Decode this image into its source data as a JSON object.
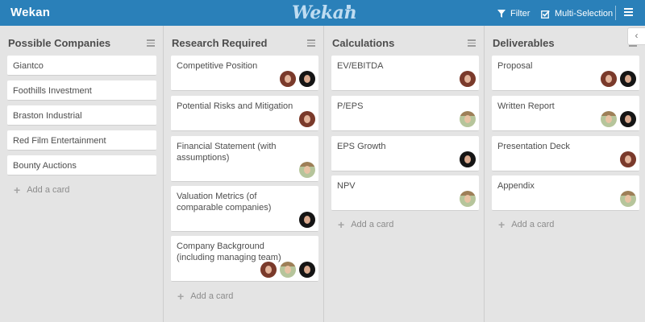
{
  "topbar": {
    "board_title": "Wekan",
    "logo_text": "Wekan",
    "filter_label": "Filter",
    "multi_selection_label": "Multi-Selection",
    "bg_color": "#2a80b9"
  },
  "lists": [
    {
      "title": "Possible Companies",
      "add_card_label": "Add a card",
      "cards": [
        {
          "title": "Giantco",
          "members": []
        },
        {
          "title": "Foothills Investment",
          "members": []
        },
        {
          "title": "Braston Industrial",
          "members": []
        },
        {
          "title": "Red Film Entertainment",
          "members": []
        },
        {
          "title": "Bounty Auctions",
          "members": []
        }
      ]
    },
    {
      "title": "Research Required",
      "add_card_label": "Add a card",
      "cards": [
        {
          "title": "Competitive Position",
          "members": [
            "woman-red-hair-avatar",
            "woman-dark-hair-avatar"
          ]
        },
        {
          "title": "Potential Risks and Mitigation",
          "members": [
            "woman-red-hair-avatar"
          ]
        },
        {
          "title": "Financial Statement (with assumptions)",
          "members": [
            "boy-avatar"
          ]
        },
        {
          "title": "Valuation Metrics (of comparable companies)",
          "members": [
            "woman-dark-hair-avatar"
          ]
        },
        {
          "title": "Company Background (including managing team)",
          "members": [
            "woman-red-hair-avatar",
            "boy-avatar",
            "woman-dark-hair-avatar"
          ]
        }
      ]
    },
    {
      "title": "Calculations",
      "add_card_label": "Add a card",
      "cards": [
        {
          "title": "EV/EBITDA",
          "members": [
            "woman-red-hair-avatar"
          ]
        },
        {
          "title": "P/EPS",
          "members": [
            "boy-avatar"
          ]
        },
        {
          "title": "EPS Growth",
          "members": [
            "woman-dark-hair-avatar"
          ]
        },
        {
          "title": "NPV",
          "members": [
            "boy-avatar"
          ]
        }
      ]
    },
    {
      "title": "Deliverables",
      "add_card_label": "Add a card",
      "cards": [
        {
          "title": "Proposal",
          "members": [
            "woman-red-hair-avatar",
            "woman-dark-hair-avatar"
          ]
        },
        {
          "title": "Written Report",
          "members": [
            "boy-avatar",
            "woman-dark-hair-avatar"
          ]
        },
        {
          "title": "Presentation Deck",
          "members": [
            "woman-red-hair-avatar"
          ]
        },
        {
          "title": "Appendix",
          "members": [
            "boy-avatar"
          ]
        }
      ]
    }
  ]
}
